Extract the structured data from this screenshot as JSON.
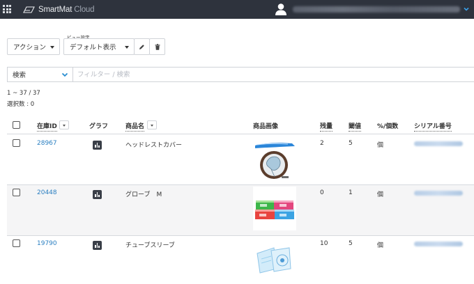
{
  "header": {
    "brand_main": "SmartMat ",
    "brand_cloud": "Cloud"
  },
  "toolbar": {
    "view_caption": "ビュー設定",
    "action_label": "アクション",
    "view_label": "デフォルト表示"
  },
  "search": {
    "select_label": "検索",
    "filter_placeholder": "フィルター / 検索"
  },
  "summary": {
    "count": "1 ~ 37 / 37",
    "selected": "選択数 : 0"
  },
  "table": {
    "headers": {
      "stock_id": "在庫ID",
      "graph": "グラフ",
      "product_name": "商品名",
      "product_image": "商品画像",
      "remaining": "残量",
      "threshold": "閾値",
      "unit": "%/個数",
      "serial": "シリアル番号"
    },
    "rows": [
      {
        "stock_id": "28967",
        "name": "ヘッドレストカバー",
        "remaining": "2",
        "threshold": "5",
        "unit": "個"
      },
      {
        "stock_id": "20448",
        "name": "グローブ　M",
        "remaining": "0",
        "threshold": "1",
        "unit": "個"
      },
      {
        "stock_id": "19790",
        "name": "チューブスリーブ",
        "remaining": "10",
        "threshold": "5",
        "unit": "個"
      }
    ]
  },
  "colors": {
    "header_bg": "#2e333d",
    "link": "#2a7fc1",
    "accent": "#2b8ed1"
  }
}
